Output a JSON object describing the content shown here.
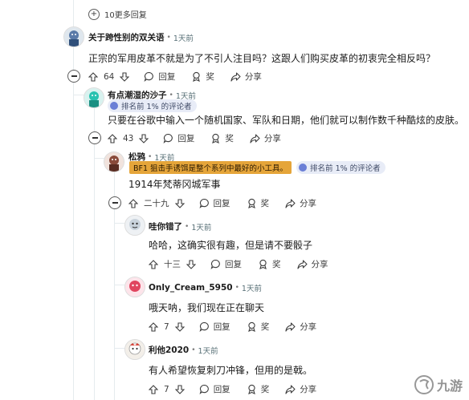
{
  "more_replies": {
    "label": "10更多回复"
  },
  "comments": [
    {
      "username": "关于跨性别的双关语",
      "time": "1天前",
      "text": "正宗的军用皮革不就是为了不引人注目吗？这跟人们购买皮革的初衷完全相反吗？",
      "votes": "64",
      "reply": "回复",
      "award": "奖",
      "share": "分享"
    },
    {
      "username": "有点潮湿的沙子",
      "time": "1天前",
      "badge": "排名前 1% 的评论者",
      "text": "只要在谷歌中输入一个随机国家、军队和日期，他们就可以制作数千种酷炫的皮肤。",
      "votes": "43",
      "reply": "回复",
      "award": "奖",
      "share": "分享"
    },
    {
      "username": "松鸦",
      "time": "1天前",
      "flair": "BF1 狙击手诱饵是整个系列中最好的小工具。",
      "badge": "排名前 1% 的评论者",
      "text": "1914年梵蒂冈城军事",
      "votes": "二十九",
      "reply": "回复",
      "award": "奖",
      "share": "分享"
    },
    {
      "username": "哇你错了",
      "time": "1天前",
      "text": "哈哈，这确实很有趣，但是请不要骰子",
      "votes": "十三",
      "reply": "回复",
      "award": "奖",
      "share": "分享"
    },
    {
      "username": "Only_Cream_5950",
      "time": "1天前",
      "text": "哦天呐，我们现在正在聊天",
      "votes": "7",
      "reply": "回复",
      "award": "奖",
      "share": "分享"
    },
    {
      "username": "利他2020",
      "time": "1天前",
      "text": "有人希望恢复刺刀冲锋，但用的是戟。",
      "votes": "7",
      "reply": "回复",
      "award": "奖",
      "share": "分享"
    }
  ],
  "watermark": {
    "text": "九游"
  }
}
